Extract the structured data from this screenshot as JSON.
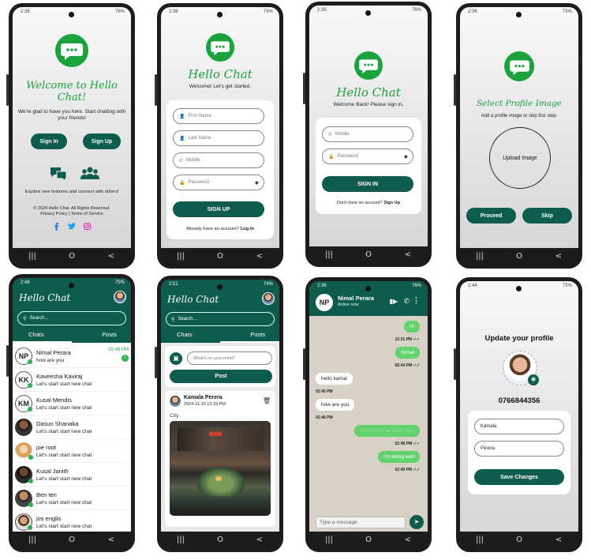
{
  "colors": {
    "primary": "#0e5c4d",
    "brand_green": "#1aa33c",
    "online": "#2bb24c"
  },
  "nav": {
    "recent": "|||",
    "home": "O",
    "back": "<"
  },
  "s1": {
    "time": "2:36",
    "battery": "76%",
    "title": "Welcome to Hello Chat!",
    "subtitle": "We're glad to have you here. Start chatting with your friends!",
    "signin": "Sign In",
    "signup": "Sign Up",
    "explore": "Explore new features and connect with others!",
    "copyright": "© 2024 Hello Chat. All Rights Reserved.",
    "links": "Privacy Policy | Terms of Service",
    "social": [
      "facebook-icon",
      "twitter-icon",
      "instagram-icon"
    ]
  },
  "s2": {
    "time": "2:36",
    "battery": "76%",
    "title": "Hello Chat",
    "subtitle": "Welcome! Let's get started.",
    "first": "First Name",
    "last": "Last Name",
    "mobile": "Mobile",
    "password": "Password",
    "button": "SIGN UP",
    "footer": "Already have an account?",
    "footer_link": "Log In"
  },
  "s3": {
    "time": "2:36",
    "battery": "76%",
    "title": "Hello Chat",
    "subtitle": "Welcome Back! Please sign in.",
    "mobile": "Mobile",
    "password": "Password",
    "button": "SIGN IN",
    "footer": "Don't have an account?",
    "footer_link": "Sign Up"
  },
  "s4": {
    "time": "2:36",
    "battery": "75%",
    "title": "Select Profile Image",
    "subtitle": "Add a profile image or skip this step.",
    "upload": "Upload Image",
    "proceed": "Proceed",
    "skip": "Skip"
  },
  "s5": {
    "time": "2:48",
    "battery": "75%",
    "title": "Hello Chat",
    "search": "Search...",
    "tab_chats": "Chats",
    "tab_posts": "Posts",
    "chats": [
      {
        "initials": "NP",
        "name": "Nimal Perara",
        "msg": "how are you",
        "time": "02:46 PM",
        "badge": "1"
      },
      {
        "initials": "KK",
        "name": "Kaveesha Kaviraj",
        "msg": "Let's start start new chat",
        "time": "",
        "badge": ""
      },
      {
        "initials": "KM",
        "name": "Kusal Mendis",
        "msg": "Let's start start new chat",
        "time": "",
        "badge": ""
      },
      {
        "initials": "",
        "name": "Dasun Shanaka",
        "msg": "Let's start start new chat",
        "time": "",
        "badge": ""
      },
      {
        "initials": "",
        "name": "joe root",
        "msg": "Let's start start new chat",
        "time": "",
        "badge": ""
      },
      {
        "initials": "",
        "name": "Kusal  Janith",
        "msg": "Let's start start new chat",
        "time": "",
        "badge": ""
      },
      {
        "initials": "",
        "name": "Ben ten",
        "msg": "Let's start start new chat",
        "time": "",
        "badge": ""
      },
      {
        "initials": "",
        "name": "jos englis",
        "msg": "Let's start start new chat",
        "time": "",
        "badge": ""
      }
    ]
  },
  "s6": {
    "time": "2:51",
    "battery": "74%",
    "title": "Hello Chat",
    "search": "Search...",
    "tab_chats": "Chats",
    "tab_posts": "Posts",
    "mind": "What's on your mind?",
    "post_btn": "Post",
    "author": "Kamala Perera",
    "date": "2024-11-10 12:33 PM",
    "caption": "City"
  },
  "s7": {
    "time": "2:36",
    "battery": "76%",
    "initials": "NP",
    "name": "Nimal Perara",
    "status": "Active now",
    "placeholder": "Type a message",
    "messages": [
      {
        "dir": "out",
        "text": "Hi",
        "time": "12:31 PM"
      },
      {
        "dir": "out",
        "text": "Nimal",
        "time": "02:44 PM"
      },
      {
        "dir": "in",
        "text": "hello kamal",
        "time": "02:45 PM"
      },
      {
        "dir": "in",
        "text": "how are you",
        "time": "02:46 PM"
      },
      {
        "dir": "out",
        "text": "Not Bad what about you",
        "time": "02:48 PM"
      },
      {
        "dir": "out",
        "text": "I'm doing well",
        "time": "02:49 PM"
      }
    ]
  },
  "s8": {
    "time": "2:44",
    "battery": "75%",
    "title": "Update your profile",
    "phone": "0766844356",
    "first": "Kamala",
    "last": "Perera",
    "button": "Save Changes"
  }
}
